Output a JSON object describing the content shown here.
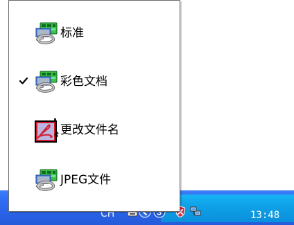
{
  "menu": {
    "items": [
      {
        "label": "标准",
        "checked": false,
        "icon": "scanner-icon"
      },
      {
        "label": "彩色文档",
        "checked": true,
        "icon": "scanner-icon"
      },
      {
        "label": "更改文件名",
        "checked": false,
        "icon": "pdf-rename-icon"
      },
      {
        "label": "JPEG文件",
        "checked": false,
        "icon": "scanner-icon"
      }
    ]
  },
  "taskbar": {
    "language": "CH",
    "clock": "13:48",
    "tray_icons": [
      "keyboard-icon",
      "back-arrow-icon",
      "blue-circle-icon",
      "shield-icon",
      "network-icon"
    ]
  }
}
